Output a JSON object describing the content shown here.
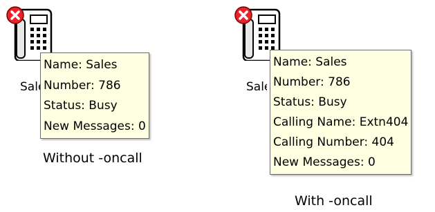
{
  "icons": {
    "device": "desk-phone-icon",
    "status_overlay": "error-x-icon",
    "status_color": "#e8232b"
  },
  "colors": {
    "tooltip_background": "#ffffe1",
    "tooltip_border": "#6b6b6b"
  },
  "left_example": {
    "device_label": "Sales",
    "tooltip": {
      "name": "Name: Sales",
      "number": "Number: 786",
      "status": "Status: Busy",
      "new_messages": "New Messages: 0"
    },
    "caption": "Without -oncall"
  },
  "right_example": {
    "device_label": "Sales",
    "tooltip": {
      "name": "Name: Sales",
      "number": "Number: 786",
      "status": "Status: Busy",
      "calling_name": "Calling Name: Extn404",
      "calling_number": "Calling Number: 404",
      "new_messages": "New Messages: 0"
    },
    "caption": "With -oncall"
  }
}
